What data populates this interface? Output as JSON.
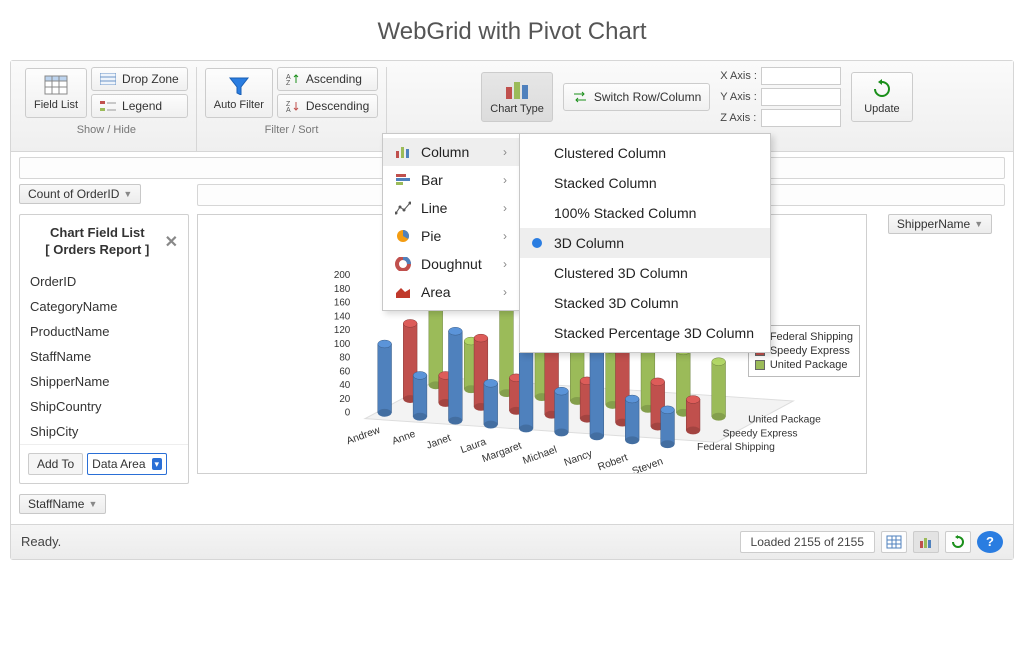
{
  "title": "WebGrid with Pivot Chart",
  "ribbon": {
    "showhide": {
      "caption": "Show / Hide",
      "field_list": "Field List",
      "drop_zone": "Drop Zone",
      "legend": "Legend"
    },
    "filtersort": {
      "caption": "Filter / Sort",
      "auto_filter": "Auto Filter",
      "ascending": "Ascending",
      "descending": "Descending"
    },
    "chart": {
      "chart_type": "Chart Type",
      "switch": "Switch Row/Column",
      "xaxis": "X Axis :",
      "yaxis": "Y Axis :",
      "zaxis": "Z Axis :",
      "xval": "",
      "yval": "",
      "zval": "",
      "update": "Update"
    }
  },
  "chips": {
    "data": "Count of OrderID",
    "row": "StaffName",
    "col": "ShipperName"
  },
  "field_list": {
    "title1": "Chart Field List",
    "title2": "[ Orders Report ]",
    "fields": [
      "OrderID",
      "CategoryName",
      "ProductName",
      "StaffName",
      "ShipperName",
      "ShipCountry",
      "ShipCity"
    ],
    "add_to": "Add To",
    "area": "Data Area"
  },
  "chart_type_menu": {
    "items": [
      {
        "label": "Column",
        "icon": "column",
        "active": true
      },
      {
        "label": "Bar",
        "icon": "bar"
      },
      {
        "label": "Line",
        "icon": "line"
      },
      {
        "label": "Pie",
        "icon": "pie"
      },
      {
        "label": "Doughnut",
        "icon": "doughnut"
      },
      {
        "label": "Area",
        "icon": "area"
      }
    ],
    "submenu_for": "Column",
    "subitems": [
      {
        "label": "Clustered Column"
      },
      {
        "label": "Stacked Column"
      },
      {
        "label": "100% Stacked Column"
      },
      {
        "label": "3D Column",
        "selected": true
      },
      {
        "label": "Clustered 3D Column"
      },
      {
        "label": "Stacked 3D Column"
      },
      {
        "label": "Stacked Percentage 3D Column"
      }
    ]
  },
  "legend": {
    "series": [
      {
        "name": "Federal Shipping",
        "color": "#4f81bd"
      },
      {
        "name": "Speedy Express",
        "color": "#c0504d"
      },
      {
        "name": "United Package",
        "color": "#9bbb59"
      }
    ]
  },
  "status": {
    "ready": "Ready.",
    "loaded": "Loaded 2155 of 2155"
  },
  "chart_data": {
    "type": "bar",
    "title": "",
    "xlabel": "",
    "ylabel": "",
    "ylim": [
      0,
      200
    ],
    "yticks": [
      0,
      20,
      40,
      60,
      80,
      100,
      120,
      140,
      160,
      180,
      200
    ],
    "categories": [
      "Andrew",
      "Anne",
      "Janet",
      "Laura",
      "Margaret",
      "Michael",
      "Nancy",
      "Robert",
      "Steven"
    ],
    "depth_categories": [
      "Federal Shipping",
      "Speedy Express",
      "United Package"
    ],
    "series": [
      {
        "name": "Federal Shipping",
        "color": "#4f81bd",
        "values": [
          100,
          60,
          130,
          60,
          150,
          60,
          168,
          60,
          50
        ]
      },
      {
        "name": "Speedy Express",
        "color": "#c0504d",
        "values": [
          110,
          40,
          100,
          48,
          135,
          55,
          140,
          65,
          45
        ]
      },
      {
        "name": "United Package",
        "color": "#9bbb59",
        "values": [
          128,
          70,
          185,
          72,
          195,
          80,
          200,
          90,
          80
        ]
      }
    ]
  }
}
